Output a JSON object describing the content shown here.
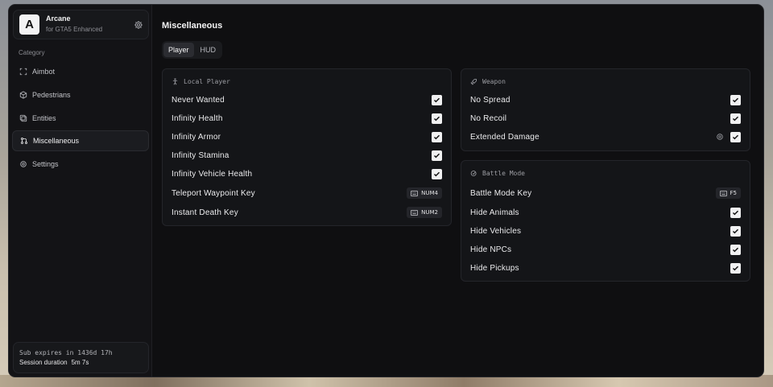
{
  "app": {
    "logo_letter": "A",
    "title": "Arcane",
    "subtitle": "for GTA5 Enhanced"
  },
  "sidebar": {
    "category_label": "Category",
    "items": [
      {
        "label": "Aimbot",
        "icon": "crosshair-icon",
        "active": false
      },
      {
        "label": "Pedestrians",
        "icon": "cube-icon",
        "active": false
      },
      {
        "label": "Entities",
        "icon": "layers-icon",
        "active": false
      },
      {
        "label": "Miscellaneous",
        "icon": "grid-icon",
        "active": true
      },
      {
        "label": "Settings",
        "icon": "gear-icon",
        "active": false
      }
    ],
    "footer": {
      "subscription": "Sub expires in 1436d 17h",
      "session_label": "Session duration",
      "session_value": "5m 7s"
    }
  },
  "main": {
    "title": "Miscellaneous",
    "tabs": [
      {
        "label": "Player",
        "active": true
      },
      {
        "label": "HUD",
        "active": false
      }
    ],
    "local_player": {
      "header": "Local Player",
      "rows": [
        {
          "label": "Never Wanted",
          "checked": true
        },
        {
          "label": "Infinity Health",
          "checked": true
        },
        {
          "label": "Infinity Armor",
          "checked": true
        },
        {
          "label": "Infinity Stamina",
          "checked": true
        },
        {
          "label": "Infinity Vehicle Health",
          "checked": true
        },
        {
          "label": "Teleport Waypoint Key",
          "key": "NUM4"
        },
        {
          "label": "Instant Death Key",
          "key": "NUM2"
        }
      ]
    },
    "weapon": {
      "header": "Weapon",
      "rows": [
        {
          "label": "No Spread",
          "checked": true
        },
        {
          "label": "No Recoil",
          "checked": true
        },
        {
          "label": "Extended Damage",
          "checked": true
        }
      ]
    },
    "battle_mode": {
      "header": "Battle Mode",
      "rows": [
        {
          "label": "Battle Mode Key",
          "key": "F5"
        },
        {
          "label": "Hide Animals",
          "checked": true
        },
        {
          "label": "Hide Vehicles",
          "checked": true
        },
        {
          "label": "Hide NPCs",
          "checked": true
        },
        {
          "label": "Hide Pickups",
          "checked": true
        }
      ]
    }
  }
}
